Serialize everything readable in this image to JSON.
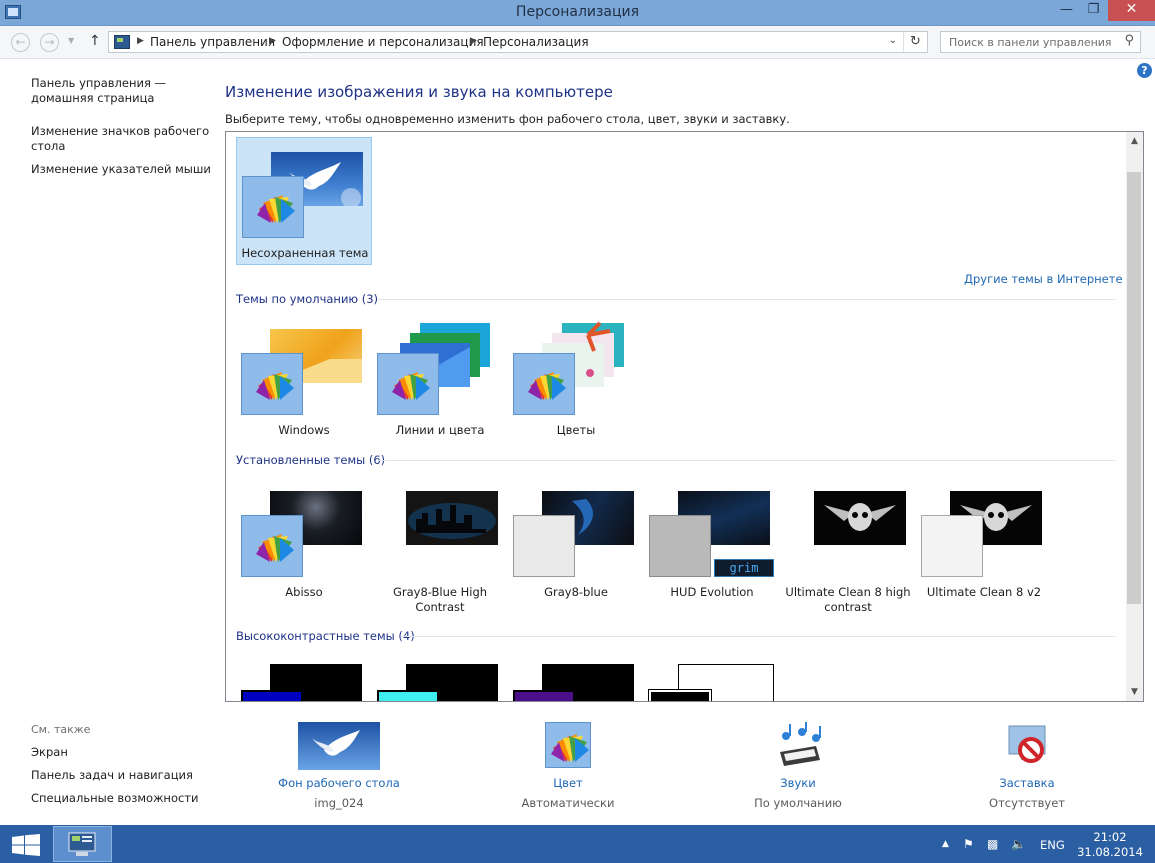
{
  "window": {
    "title": "Персонализация"
  },
  "nav": {
    "breadcrumb": [
      "Панель управления",
      "Оформление и персонализация",
      "Персонализация"
    ],
    "search_placeholder": "Поиск в панели управления"
  },
  "sidebar": {
    "links": [
      "Панель управления —\nдомашняя страница",
      "Изменение значков рабочего\nстола",
      "Изменение указателей мыши"
    ],
    "see_also_label": "См. также",
    "see_also": [
      "Экран",
      "Панель задач и навигация",
      "Специальные возможности"
    ]
  },
  "main": {
    "heading": "Изменение изображения и звука на компьютере",
    "subheading": "Выберите тему, чтобы одновременно изменить фон рабочего стола, цвет, звуки и заставку.",
    "current_theme": "Несохраненная тема",
    "online_link": "Другие темы в Интернете",
    "groups": [
      {
        "title": "Темы по умолчанию (3)",
        "themes": [
          "Windows",
          "Линии и цвета",
          "Цветы"
        ]
      },
      {
        "title": "Установленные темы (6)",
        "themes": [
          "Abisso",
          "Gray8-Blue High\nContrast",
          "Gray8-blue",
          "HUD Evolution",
          "Ultimate Clean 8 high\ncontrast",
          "Ultimate Clean 8 v2"
        ]
      },
      {
        "title": "Высококонтрастные темы (4)",
        "themes": []
      }
    ]
  },
  "settings": [
    {
      "label": "Фон рабочего стола",
      "value": "img_024",
      "icon": "desktop-background-icon"
    },
    {
      "label": "Цвет",
      "value": "Автоматически",
      "icon": "color-icon"
    },
    {
      "label": "Звуки",
      "value": "По умолчанию",
      "icon": "sounds-icon"
    },
    {
      "label": "Заставка",
      "value": "Отсутствует",
      "icon": "screensaver-icon"
    }
  ],
  "taskbar": {
    "language": "ENG",
    "time": "21:02",
    "date": "31.08.2014"
  },
  "colors": {
    "titlebar": "#7ba7d8",
    "accent_link": "#1e67b3",
    "heading": "#1e3287",
    "taskbar": "#2b5fa3"
  }
}
